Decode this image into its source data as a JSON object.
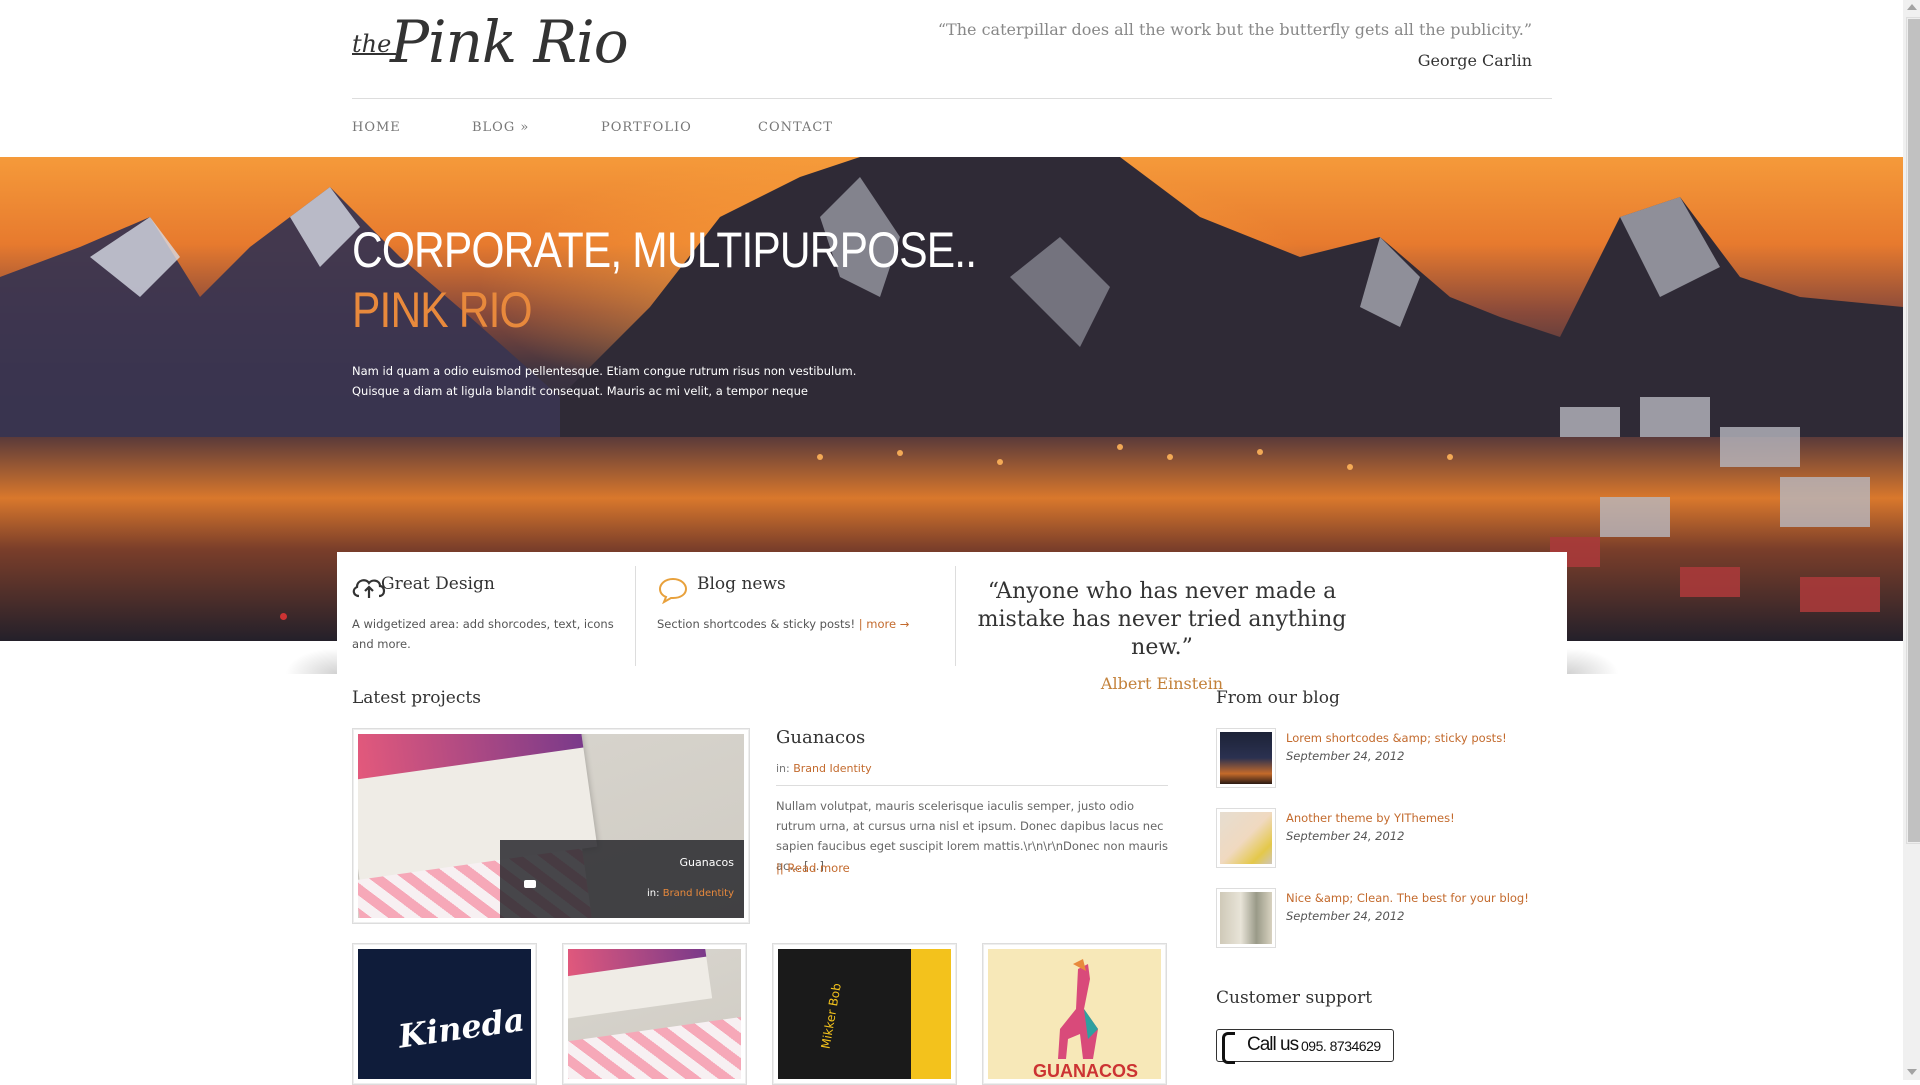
{
  "header": {
    "logo_the": "the",
    "logo_name": "Pink Rio",
    "quote": "“The caterpillar does all the work but the butterfly gets all the publicity.”",
    "quote_author": "George Carlin"
  },
  "nav": {
    "items": [
      "HOME",
      "BLOG »",
      "PORTFOLIO",
      "CONTACT"
    ]
  },
  "hero": {
    "title": "CORPORATE, MULTIPURPOSE..",
    "subtitle": "PINK RIO",
    "text": "Nam id quam a odio euismod pellentesque. Etiam congue rutrum risus non vestibulum. Quisque a diam at ligula blandit consequat. Mauris ac mi velit, a tempor neque"
  },
  "features": {
    "design_title": "Great Design",
    "design_text": "A widgetized area: add shorcodes, text, icons and more.",
    "blog_title": "Blog news",
    "blog_text": "Section shortcodes & sticky posts!",
    "blog_more": "| more →",
    "quote": "“Anyone who has never made a mistake has never tried anything new.”",
    "quote_author": "Albert Einstein"
  },
  "projects": {
    "section_title": "Latest projects",
    "featured_title": "Guanacos",
    "featured_cat_prefix": "in:",
    "featured_cat": "Brand Identity",
    "featured_text": "Nullam volutpat, mauris scelerisque iaculis semper, justo odio rutrum urna, at cursus urna nisl et ipsum. Donec dapibus lacus nec sapien faucibus eget suscipit lorem mattis.\\r\\n\\r\\nDonec non mauris ac... [...]",
    "read_more": "|| Read more",
    "overlay_title": "Guanacos",
    "overlay_cat_prefix": "in:",
    "overlay_cat": "Brand Identity",
    "thumb1_text": "Kineda",
    "thumb3_text": "Mikker Bob",
    "thumb4_text": "GUANACOS"
  },
  "blog": {
    "section_title": "From our blog",
    "posts": [
      {
        "title": "Lorem shortcodes &amp; sticky posts!",
        "date": "September 24, 2012"
      },
      {
        "title": "Another theme by YIThemes!",
        "date": "September 24, 2012"
      },
      {
        "title": "Nice &amp; Clean. The best for your blog!",
        "date": "September 24, 2012"
      }
    ]
  },
  "support": {
    "section_title": "Customer support",
    "call_label": "Call us",
    "phone": "095. 8734629"
  },
  "colors": {
    "accent": "#c36a2d",
    "hero_accent": "#e8893c"
  }
}
